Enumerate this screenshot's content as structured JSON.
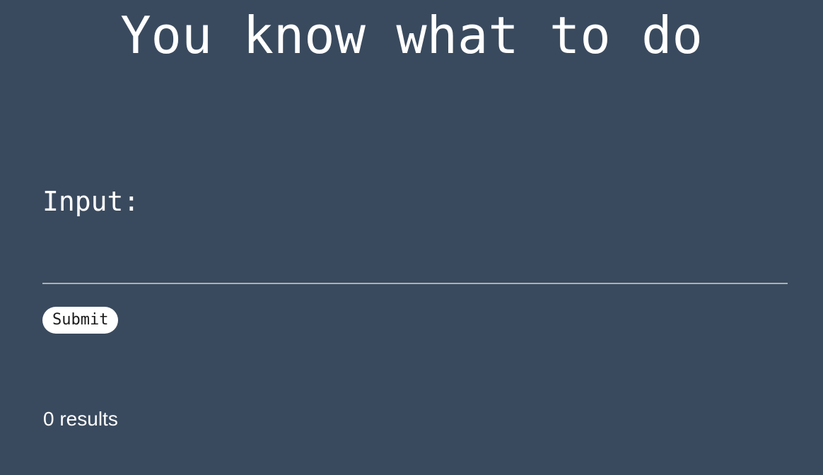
{
  "page": {
    "title": "You know what to do",
    "background_color": "#3a4a5e",
    "text_color": "#ffffff"
  },
  "form": {
    "input_label": "Input:",
    "input_value": "",
    "input_placeholder": "",
    "underline_color": "#a9b3ad",
    "submit_label": "Submit"
  },
  "results": {
    "summary": "0 results"
  }
}
